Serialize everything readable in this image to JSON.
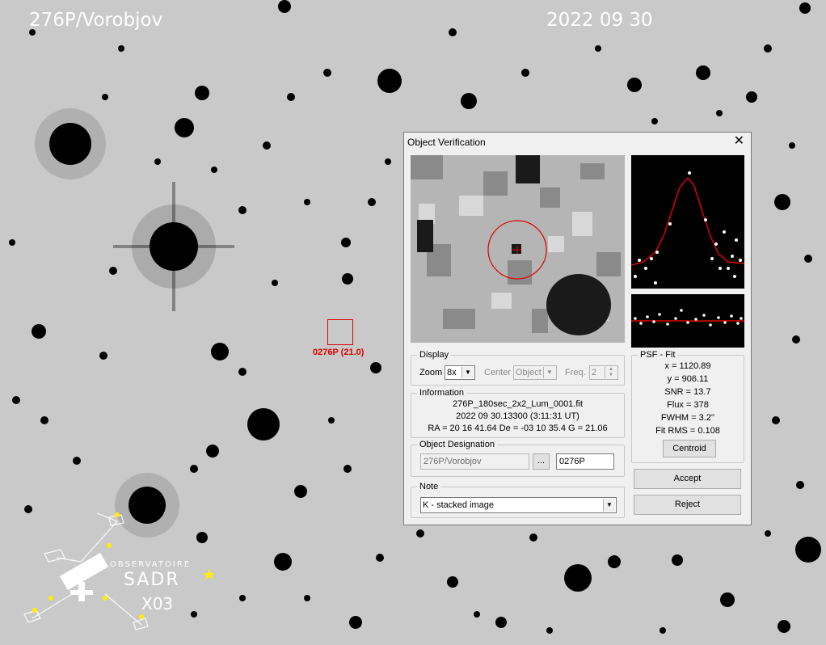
{
  "overlay": {
    "object_name": "276P/Vorobjov",
    "date": "2022 09 30",
    "target_label": "0276P (21.0)",
    "logo": {
      "line1": "OBSERVATOIRE",
      "line2": "SADR",
      "line3": "X03"
    }
  },
  "dialog": {
    "title": "Object Verification",
    "display": {
      "legend": "Display",
      "zoom_label": "Zoom",
      "zoom_value": "8x",
      "center_label": "Center",
      "center_value": "Object",
      "freq_label": "Freq.",
      "freq_value": "2"
    },
    "information": {
      "legend": "Information",
      "file": "276P_180sec_2x2_Lum_0001.fit",
      "time": "2022 09 30.13300 (3:11:31 UT)",
      "coords": "RA = 20 16 41.64   De = -03 10 35.4   G = 21.06"
    },
    "designation": {
      "legend": "Object Designation",
      "name_value": "276P/Vorobjov",
      "browse_label": "...",
      "code_value": "0276P"
    },
    "note": {
      "legend": "Note",
      "value": "K - stacked image"
    },
    "psf": {
      "legend": "PSF - Fit",
      "x": "x = 1120.89",
      "y": "y = 906.11",
      "snr": "SNR = 13.7",
      "flux": "Flux = 378",
      "fwhm": "FWHM = 3.2''",
      "fit_rms": "Fit RMS = 0.108",
      "centroid_label": "Centroid"
    },
    "accept_label": "Accept",
    "reject_label": "Reject"
  },
  "colors": {
    "marker": "#e00000",
    "dialog_bg": "#f0f0f0",
    "sky_bg": "#c9c9c9",
    "logo_star": "#ffee00"
  },
  "icons": [
    "close-icon",
    "chevron-down-icon",
    "spin-up-icon",
    "spin-down-icon",
    "telescope-icon",
    "star-icon"
  ]
}
